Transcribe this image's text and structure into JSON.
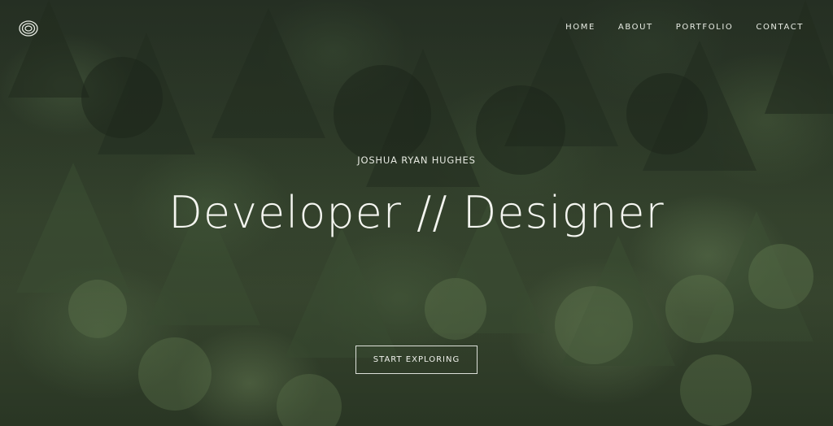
{
  "nav": {
    "items": [
      {
        "label": "HOME"
      },
      {
        "label": "ABOUT"
      },
      {
        "label": "PORTFOLIO"
      },
      {
        "label": "CONTACT"
      }
    ]
  },
  "hero": {
    "subtitle": "JOSHUA RYAN HUGHES",
    "headline": "Developer // Designer",
    "cta_label": "START EXPLORING",
    "background": "aerial-forest-image"
  },
  "logo": {
    "icon": "swirl-logo-icon"
  },
  "colors": {
    "text": "#f4f5f0",
    "forest_dark": "#2e3a2c",
    "forest_light": "#789262"
  }
}
